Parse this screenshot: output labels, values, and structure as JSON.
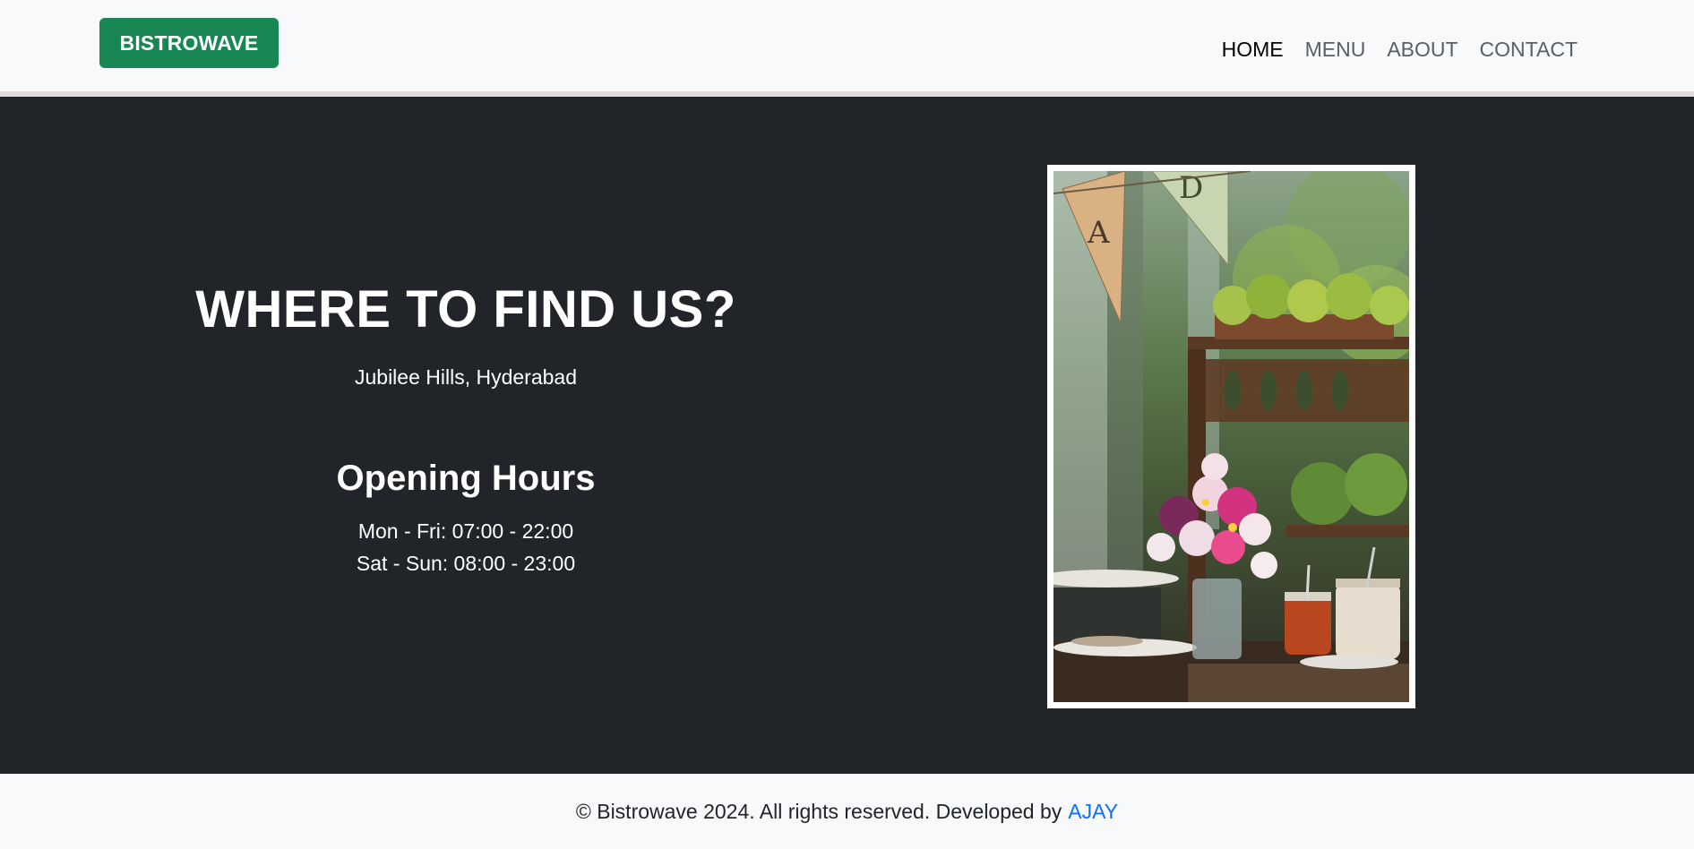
{
  "navbar": {
    "brand": "BISTROWAVE",
    "links": [
      {
        "label": "HOME",
        "active": true
      },
      {
        "label": "MENU",
        "active": false
      },
      {
        "label": "ABOUT",
        "active": false
      },
      {
        "label": "CONTACT",
        "active": false
      }
    ]
  },
  "main": {
    "headline": "WHERE TO FIND US?",
    "address": "Jubilee Hills, Hyderabad",
    "hours_title": "Opening Hours",
    "hours": [
      "Mon - Fri: 07:00 - 22:00",
      "Sat - Sun: 08:00 - 23:00"
    ],
    "photo_flags": [
      "A",
      "D"
    ]
  },
  "footer": {
    "text": "© Bistrowave 2024. All rights reserved. Developed by",
    "author": "AJAY"
  },
  "colors": {
    "brand": "#198754",
    "dark_bg": "#212529",
    "light_bg": "#f8f9fa",
    "link": "#0d6efd"
  }
}
